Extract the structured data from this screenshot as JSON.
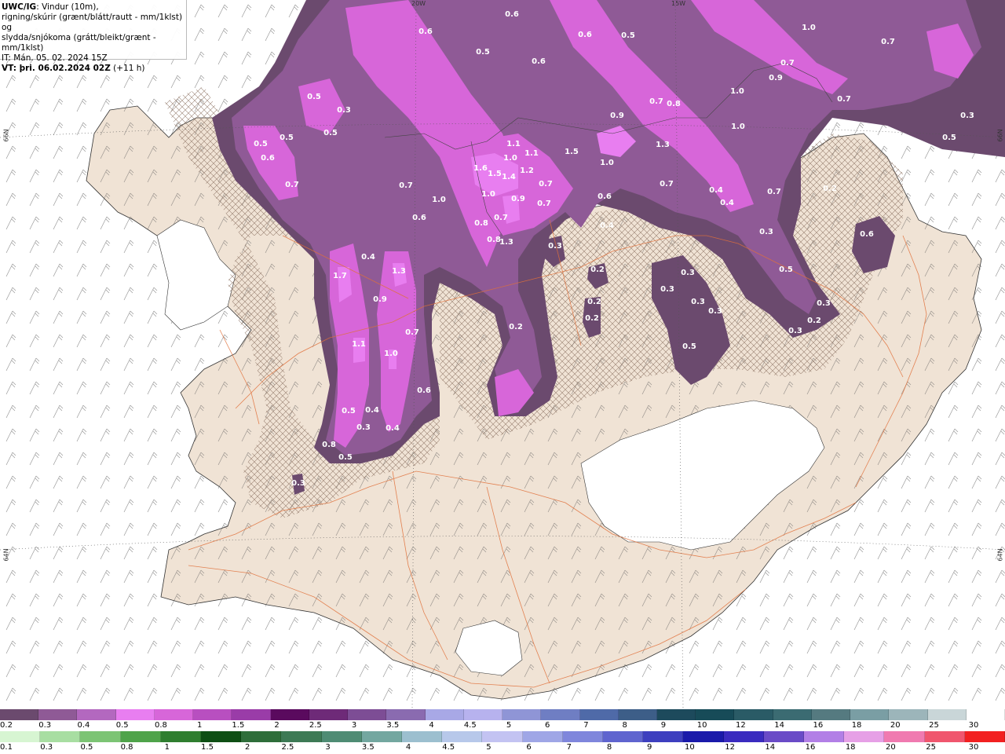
{
  "header": {
    "line1_bold": "UWC/IG",
    "line1_rest": ": Vindur (10m),",
    "line2": "rigning/skúrir (grænt/blátt/rautt - mm/1klst) og",
    "line3": "slydda/snjókoma (grátt/bleikt/grænt - mm/1klst)",
    "line4": "IT: Mán. 05. 02. 2024 15Z",
    "line5_bold": "VT: þri. 06.02.2024 02Z",
    "line5_rest": " (+11 h)"
  },
  "graticule": {
    "lat_left_top": "66N",
    "lat_left_bottom": "64N",
    "lat_right_top": "66N",
    "lat_right_bottom": "64N",
    "lon_top_1": "20W",
    "lon_top_2": "15W"
  },
  "legend": {
    "top": {
      "labels": [
        "0.2",
        "0.3",
        "0.4",
        "0.5",
        "0.8",
        "1",
        "1.5",
        "2",
        "2.5",
        "3",
        "3.5",
        "4",
        "4.5",
        "5",
        "6",
        "7",
        "8",
        "9",
        "10",
        "12",
        "14",
        "16",
        "18",
        "20",
        "25",
        "30"
      ],
      "colors": [
        "#6b4a6e",
        "#8f5a96",
        "#b368bf",
        "#e87ef0",
        "#d766d9",
        "#b84fc0",
        "#9a3ca8",
        "#5a0a5e",
        "#6e2a78",
        "#7d4d95",
        "#8a6bb0",
        "#a8a8e6",
        "#b7b2ee",
        "#8f95d6",
        "#6f7ec3",
        "#4f6aa8",
        "#3d5e88",
        "#1d4a5c",
        "#174b58",
        "#2a5b66",
        "#3b6b72",
        "#557a80",
        "#7a9ea4",
        "#9cb5ba",
        "#c9d6d8",
        "#ffffff"
      ]
    },
    "bottom": {
      "labels": [
        "0.1",
        "0.3",
        "0.5",
        "0.8",
        "1",
        "1.5",
        "2",
        "2.5",
        "3",
        "3.5",
        "4",
        "4.5",
        "5",
        "6",
        "7",
        "8",
        "9",
        "10",
        "12",
        "14",
        "16",
        "18",
        "20",
        "25",
        "30"
      ],
      "colors": [
        "#d7f5d2",
        "#a8dea2",
        "#7cc474",
        "#4fa34a",
        "#2f7e2f",
        "#0e4f14",
        "#2e6e3a",
        "#3d7a55",
        "#4f8c74",
        "#73a7a0",
        "#9cbfcf",
        "#b7c8ea",
        "#c3c3f2",
        "#9fa6e6",
        "#7f86dc",
        "#5f64cf",
        "#3d3fbf",
        "#1a1aaa",
        "#3a2bbf",
        "#6a4bc7",
        "#b27fe6",
        "#e6a0e6",
        "#f07ab0",
        "#f0566e",
        "#f22020"
      ]
    },
    "bottom_edge_label": "0.1"
  },
  "precip_values": [
    {
      "v": "0.6"
    },
    {
      "v": "0.6"
    },
    {
      "v": "0.5"
    },
    {
      "v": "0.6"
    },
    {
      "v": "0.6"
    },
    {
      "v": "0.5"
    },
    {
      "v": "1.0"
    },
    {
      "v": "0.7"
    },
    {
      "v": "0.7"
    },
    {
      "v": "0.9"
    },
    {
      "v": "0.5"
    },
    {
      "v": "0.3"
    },
    {
      "v": "0.5"
    },
    {
      "v": "0.5"
    },
    {
      "v": "0.5"
    },
    {
      "v": "0.6"
    },
    {
      "v": "0.7"
    },
    {
      "v": "0.7"
    },
    {
      "v": "0.8"
    },
    {
      "v": "0.9"
    },
    {
      "v": "1.0"
    },
    {
      "v": "1.0"
    },
    {
      "v": "0.7"
    },
    {
      "v": "0.3"
    },
    {
      "v": "0.5"
    },
    {
      "v": "1.1"
    },
    {
      "v": "1.0"
    },
    {
      "v": "1.1"
    },
    {
      "v": "1.5"
    },
    {
      "v": "1.0"
    },
    {
      "v": "1.3"
    },
    {
      "v": "1.6"
    },
    {
      "v": "1.5"
    },
    {
      "v": "1.4"
    },
    {
      "v": "1.2"
    },
    {
      "v": "0.7"
    },
    {
      "v": "0.7"
    },
    {
      "v": "1.0"
    },
    {
      "v": "0.9"
    },
    {
      "v": "0.7"
    },
    {
      "v": "0.6"
    },
    {
      "v": "0.7"
    },
    {
      "v": "0.4"
    },
    {
      "v": "0.4"
    },
    {
      "v": "0.7"
    },
    {
      "v": "0.2"
    },
    {
      "v": "0.6"
    },
    {
      "v": "1.0"
    },
    {
      "v": "0.7"
    },
    {
      "v": "0.8"
    },
    {
      "v": "0.8"
    },
    {
      "v": "1.3"
    },
    {
      "v": "0.3"
    },
    {
      "v": "0.4"
    },
    {
      "v": "0.3"
    },
    {
      "v": "0.6"
    },
    {
      "v": "0.4"
    },
    {
      "v": "0.2"
    },
    {
      "v": "0.3"
    },
    {
      "v": "0.5"
    },
    {
      "v": "1.7"
    },
    {
      "v": "1.3"
    },
    {
      "v": "0.9"
    },
    {
      "v": "0.7"
    },
    {
      "v": "1.1"
    },
    {
      "v": "1.0"
    },
    {
      "v": "0.3"
    },
    {
      "v": "0.2"
    },
    {
      "v": "0.2"
    },
    {
      "v": "0.3"
    },
    {
      "v": "0.3"
    },
    {
      "v": "0.3"
    },
    {
      "v": "0.5"
    },
    {
      "v": "0.2"
    },
    {
      "v": "0.3"
    },
    {
      "v": "0.2"
    },
    {
      "v": "0.4"
    },
    {
      "v": "0.6"
    },
    {
      "v": "0.5"
    },
    {
      "v": "0.4"
    },
    {
      "v": "0.3"
    },
    {
      "v": "0.8"
    },
    {
      "v": "0.5"
    },
    {
      "v": "0.3"
    },
    {
      "v": "0.2"
    },
    {
      "v": "0.2"
    }
  ]
}
